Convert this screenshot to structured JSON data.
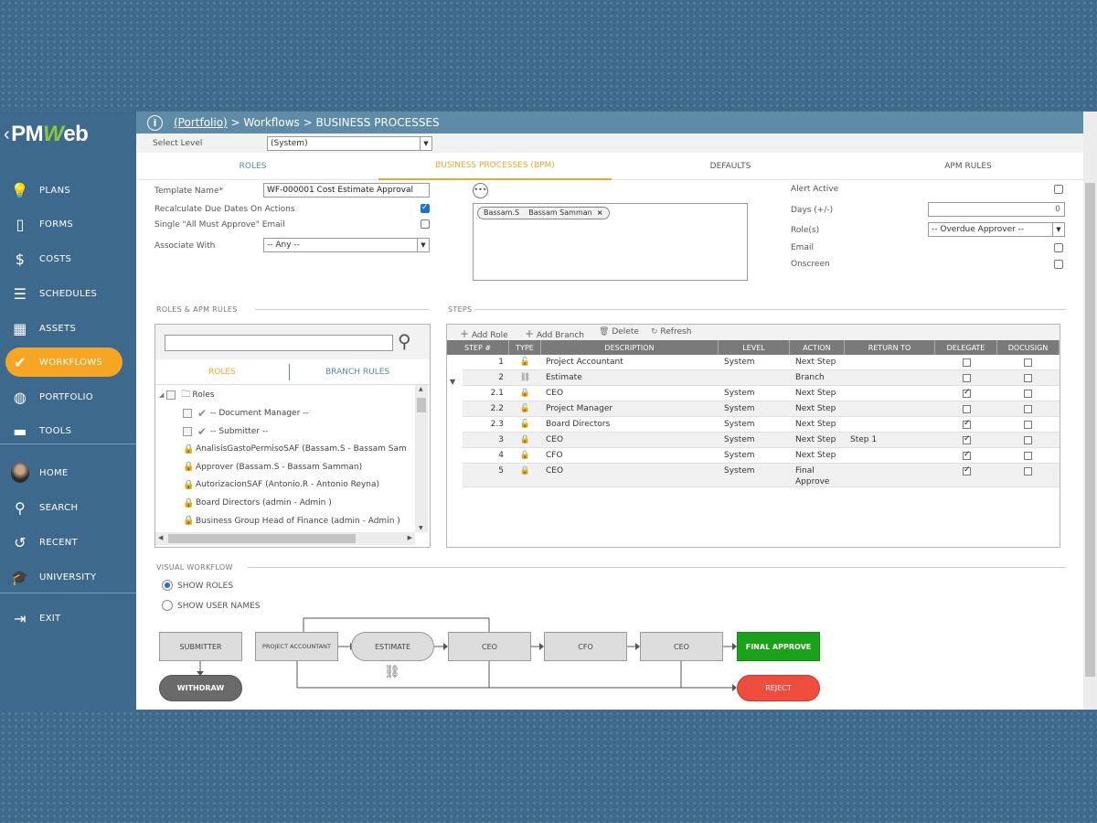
{
  "app": {
    "logo": "PMWeb",
    "logo_w": "W",
    "logo_rest_1": "PM",
    "logo_rest_2": "eb"
  },
  "breadcrumb": {
    "link": "(Portfolio)",
    "rest": " > Workflows > BUSINESS PROCESSES"
  },
  "level": {
    "label": "Select Level",
    "value": "(System)"
  },
  "tabs": [
    "ROLES",
    "BUSINESS PROCESSES (BPM)",
    "DEFAULTS",
    "APM RULES"
  ],
  "sidebar": [
    {
      "label": "PLANS",
      "icon": "lightbulb-icon",
      "glyph": "💡"
    },
    {
      "label": "FORMS",
      "icon": "document-icon",
      "glyph": "▯"
    },
    {
      "label": "COSTS",
      "icon": "dollar-icon",
      "glyph": "$"
    },
    {
      "label": "SCHEDULES",
      "icon": "schedule-icon",
      "glyph": "☰"
    },
    {
      "label": "ASSETS",
      "icon": "building-icon",
      "glyph": "▦"
    },
    {
      "label": "WORKFLOWS",
      "icon": "check-icon",
      "glyph": "✔"
    },
    {
      "label": "PORTFOLIO",
      "icon": "globe-icon",
      "glyph": "◍"
    },
    {
      "label": "TOOLS",
      "icon": "toolbox-icon",
      "glyph": "▬"
    },
    {
      "label": "HOME",
      "icon": "avatar-icon",
      "glyph": ""
    },
    {
      "label": "SEARCH",
      "icon": "search-icon",
      "glyph": "⚲"
    },
    {
      "label": "RECENT",
      "icon": "history-icon",
      "glyph": "↺"
    },
    {
      "label": "UNIVERSITY",
      "icon": "graduation-cap-icon",
      "glyph": "🎓"
    },
    {
      "label": "EXIT",
      "icon": "exit-icon",
      "glyph": "⇥"
    }
  ],
  "form": {
    "template_name_label": "Template Name*",
    "template_name_value": "WF-000001 Cost Estimate Approval",
    "recalc_label": "Recalculate Due Dates On Actions",
    "recalc_checked": true,
    "single_email_label": "Single \"All Must Approve\" Email",
    "single_email_checked": false,
    "associate_label": "Associate With",
    "associate_value": "-- Any --",
    "more_icon": "•••",
    "tag_user": "Bassam.S",
    "tag_name": "Bassam Samman",
    "tag_remove": "×"
  },
  "alerts": {
    "alert_active_label": "Alert Active",
    "days_label": "Days (+/-)",
    "days_value": "0",
    "roles_label": "Role(s)",
    "roles_value": "-- Overdue Approver --",
    "email_label": "Email",
    "onscreen_label": "Onscreen"
  },
  "roles_panel": {
    "section_title": "ROLES & APM RULES",
    "search_value": "",
    "tab_roles": "ROLES",
    "tab_branch": "BRANCH RULES",
    "root": "Roles",
    "items": [
      {
        "text": "-- Document Manager --",
        "kind": "check"
      },
      {
        "text": "-- Submitter --",
        "kind": "check"
      },
      {
        "text": "AnalisisGastoPermisoSAF (Bassam.S - Bassam Sam",
        "kind": "lock"
      },
      {
        "text": "Approver (Bassam.S - Bassam Samman)",
        "kind": "lock"
      },
      {
        "text": "AutorizacionSAF (Antonio.R - Antonio Reyna)",
        "kind": "lock"
      },
      {
        "text": "Board Directors (admin - Admin )",
        "kind": "lock"
      },
      {
        "text": "Business Group Head of Finance (admin - Admin )",
        "kind": "lock"
      }
    ]
  },
  "steps": {
    "section_title": "STEPS",
    "toolbar": {
      "add_role": "Add Role",
      "add_branch": "Add Branch",
      "delete": "Delete",
      "refresh": "Refresh"
    },
    "columns": [
      "STEP #",
      "TYPE",
      "DESCRIPTION",
      "LEVEL",
      "ACTION",
      "RETURN TO",
      "DELEGATE",
      "DOCUSIGN"
    ],
    "rows": [
      {
        "step": "1",
        "type": "unlock",
        "desc": "Project Accountant",
        "level": "System",
        "action": "Next Step",
        "return_to": "",
        "delegate": false,
        "docusign": false,
        "indent": false,
        "shade": false
      },
      {
        "step": "2",
        "type": "branch",
        "desc": "Estimate",
        "level": "",
        "action": "Branch",
        "return_to": "",
        "delegate": false,
        "docusign": false,
        "indent": false,
        "shade": true
      },
      {
        "step": "2.1",
        "type": "lock",
        "desc": "CEO",
        "level": "System",
        "action": "Next Step",
        "return_to": "",
        "delegate": true,
        "docusign": false,
        "indent": true,
        "shade": false
      },
      {
        "step": "2.2",
        "type": "unlock",
        "desc": "Project Manager",
        "level": "System",
        "action": "Next Step",
        "return_to": "",
        "delegate": false,
        "docusign": false,
        "indent": true,
        "shade": true
      },
      {
        "step": "2.3",
        "type": "unlock",
        "desc": "Board Directors",
        "level": "System",
        "action": "Next Step",
        "return_to": "",
        "delegate": true,
        "docusign": false,
        "indent": true,
        "shade": false
      },
      {
        "step": "3",
        "type": "lock",
        "desc": "CEO",
        "level": "System",
        "action": "Next Step",
        "return_to": "Step 1",
        "delegate": true,
        "docusign": false,
        "indent": false,
        "shade": true
      },
      {
        "step": "4",
        "type": "lock",
        "desc": "CFO",
        "level": "System",
        "action": "Next Step",
        "return_to": "",
        "delegate": true,
        "docusign": false,
        "indent": false,
        "shade": false
      },
      {
        "step": "5",
        "type": "lock",
        "desc": "CEO",
        "level": "System",
        "action": "Final Approve",
        "return_to": "",
        "delegate": true,
        "docusign": false,
        "indent": false,
        "shade": true
      }
    ]
  },
  "visual": {
    "section_title": "VISUAL WORKFLOW",
    "show_roles": "SHOW ROLES",
    "show_user_names": "SHOW USER NAMES",
    "nodes": {
      "submitter": "SUBMITTER",
      "withdraw": "WITHDRAW",
      "project_accountant": "PROJECT ACCOUNTANT",
      "estimate": "ESTIMATE",
      "ceo1": "CEO",
      "cfo": "CFO",
      "ceo2": "CEO",
      "final_approve": "FINAL APPROVE",
      "reject": "REJECT"
    }
  },
  "colors": {
    "sidebar": "#3d6a8c",
    "accent": "#f6a623",
    "topbar": "#5e8ba8",
    "approve": "#1aa31a",
    "reject": "#ee4c3c"
  }
}
